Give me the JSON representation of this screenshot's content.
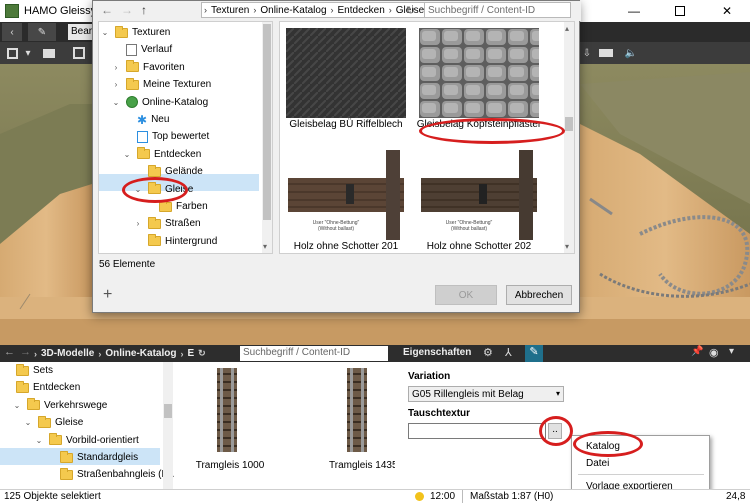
{
  "app": {
    "title": "HAMO Gleissyst",
    "tab_label": "Bearb",
    "window_controls": [
      "minimize",
      "maximize",
      "close"
    ]
  },
  "dialog": {
    "breadcrumb": [
      "Texturen",
      "Online-Katalog",
      "Entdecken",
      "Gleise"
    ],
    "search_placeholder": "Suchbegriff / Content-ID",
    "tree": [
      {
        "label": "Texturen",
        "indent": 0,
        "expander": "v",
        "icon": "folder"
      },
      {
        "label": "Verlauf",
        "indent": 1,
        "expander": "",
        "icon": "history"
      },
      {
        "label": "Favoriten",
        "indent": 1,
        "expander": ">",
        "icon": "folder"
      },
      {
        "label": "Meine Texturen",
        "indent": 1,
        "expander": ">",
        "icon": "folder"
      },
      {
        "label": "Online-Katalog",
        "indent": 1,
        "expander": "v",
        "icon": "globe"
      },
      {
        "label": "Neu",
        "indent": 2,
        "expander": "",
        "icon": "new"
      },
      {
        "label": "Top bewertet",
        "indent": 2,
        "expander": "",
        "icon": "top"
      },
      {
        "label": "Entdecken",
        "indent": 2,
        "expander": "v",
        "icon": "folder"
      },
      {
        "label": "Gelände",
        "indent": 3,
        "expander": "",
        "icon": "folder"
      },
      {
        "label": "Gleise",
        "indent": 3,
        "expander": "v",
        "icon": "folder",
        "selected": true
      },
      {
        "label": "Farben",
        "indent": 4,
        "expander": "",
        "icon": "folder"
      },
      {
        "label": "Straßen",
        "indent": 3,
        "expander": ">",
        "icon": "folder"
      },
      {
        "label": "Hintergrund",
        "indent": 3,
        "expander": "",
        "icon": "folder"
      }
    ],
    "items": [
      {
        "label": "Gleisbelag BÜ Riffelblech",
        "thumb": "steel"
      },
      {
        "label": "Gleisbelag Kopfsteinpflaster",
        "thumb": "cobble"
      },
      {
        "label": "Holz ohne Schotter 201",
        "thumb": "wood"
      },
      {
        "label": "Holz ohne Schotter 202",
        "thumb": "wood"
      }
    ],
    "thumb_caption": "User \"Ohne-Bettung\"",
    "thumb_caption2": "(Without ballast)",
    "count": "56 Elemente",
    "ok_label": "OK",
    "cancel_label": "Abbrechen"
  },
  "lower": {
    "breadcrumb": [
      "3D-Modelle",
      "Online-Katalog",
      "E"
    ],
    "search_placeholder": "Suchbegriff / Content-ID",
    "tree": [
      {
        "label": "Sets",
        "indent": 0
      },
      {
        "label": "Entdecken",
        "indent": 0
      },
      {
        "label": "Verkehrswege",
        "indent": 1,
        "expander": "v"
      },
      {
        "label": "Gleise",
        "indent": 2,
        "expander": "v"
      },
      {
        "label": "Vorbild-orientiert",
        "indent": 3,
        "expander": "v"
      },
      {
        "label": "Standardgleis",
        "indent": 4,
        "selected": true
      },
      {
        "label": "Straßenbahngleis (LA Ba",
        "indent": 4
      }
    ],
    "items": [
      {
        "label": "Tramgleis 1000"
      },
      {
        "label": "Tramgleis 1435"
      }
    ]
  },
  "props": {
    "title": "Eigenschaften",
    "variation_label": "Variation",
    "variation_value": "G05 Rillengleis mit Belag",
    "tausch_label": "Tauschtextur",
    "tausch_value": "",
    "browse_label": ".."
  },
  "context_menu": [
    "Katalog",
    "Datei",
    "Vorlage exportieren"
  ],
  "status": {
    "selected": "125 Objekte selektiert",
    "time": "12:00",
    "scale": "Maßstab 1:87 (H0)",
    "extra": "24,8"
  },
  "colors": {
    "annotation": "#d61e1e",
    "selection": "#cce4f7",
    "folder": "#f4c94e"
  }
}
